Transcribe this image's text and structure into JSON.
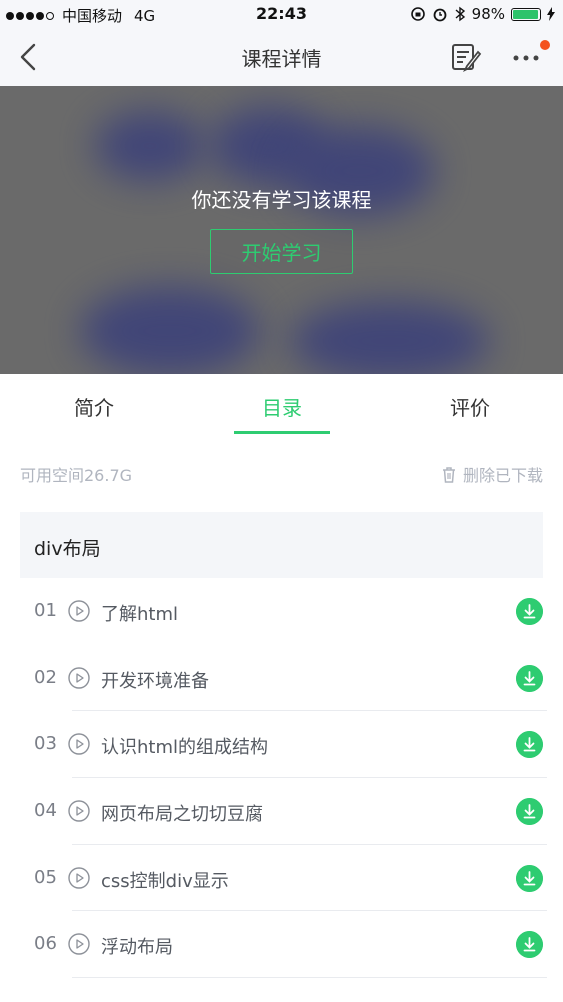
{
  "status_bar": {
    "carrier": "中国移动",
    "network": "4G",
    "time": "22:43",
    "battery": "98%",
    "battery_level": 0.98
  },
  "nav": {
    "title": "课程详情"
  },
  "hero": {
    "message": "你还没有学习该课程",
    "start_button": "开始学习"
  },
  "tabs": [
    {
      "label": "简介",
      "active": false
    },
    {
      "label": "目录",
      "active": true
    },
    {
      "label": "评价",
      "active": false
    }
  ],
  "storage": {
    "available": "可用空间26.7G",
    "delete_label": "删除已下载"
  },
  "chapter": {
    "title": "div布局"
  },
  "lessons": [
    {
      "num": "01",
      "title": "了解html"
    },
    {
      "num": "02",
      "title": "开发环境准备"
    },
    {
      "num": "03",
      "title": "认识html的组成结构"
    },
    {
      "num": "04",
      "title": "网页布局之切切豆腐"
    },
    {
      "num": "05",
      "title": "css控制div显示"
    },
    {
      "num": "06",
      "title": "浮动布局"
    }
  ],
  "colors": {
    "accent": "#2ecc71",
    "badge": "#f4511e"
  }
}
